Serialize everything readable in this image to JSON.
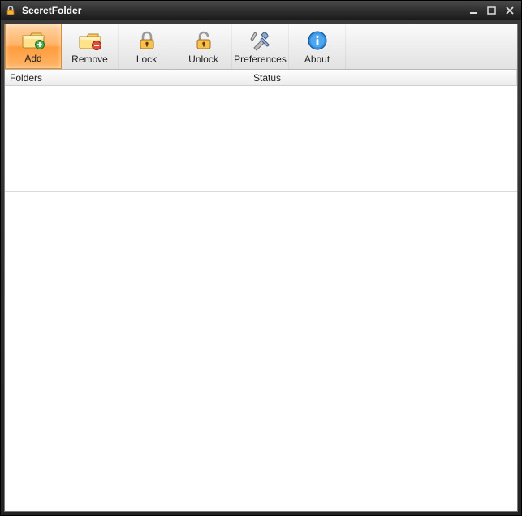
{
  "titlebar": {
    "title": "SecretFolder"
  },
  "toolbar": {
    "add": "Add",
    "remove": "Remove",
    "lock": "Lock",
    "unlock": "Unlock",
    "preferences": "Preferences",
    "about": "About"
  },
  "columns": {
    "folders": "Folders",
    "status": "Status"
  }
}
